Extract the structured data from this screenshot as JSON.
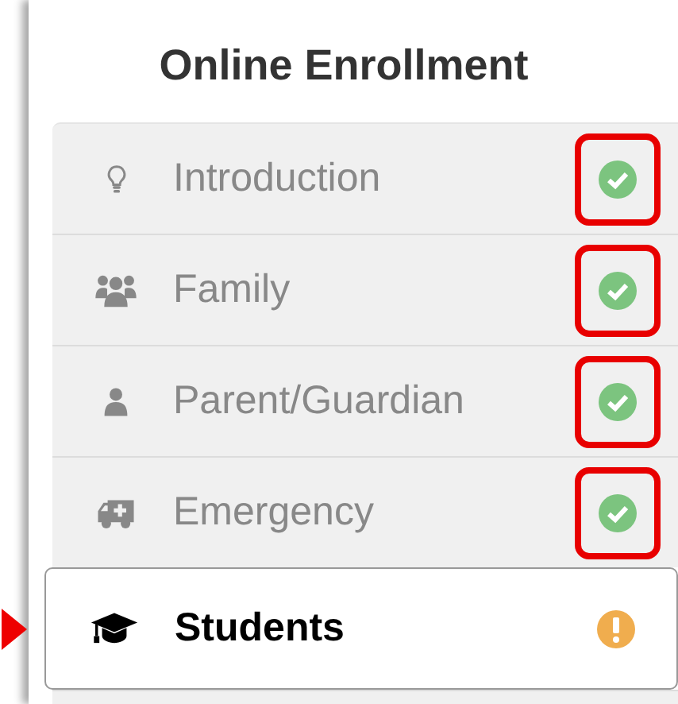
{
  "title": "Online Enrollment",
  "steps": [
    {
      "label": "Introduction",
      "complete": true,
      "selected": false,
      "highlighted": true,
      "pointed": false
    },
    {
      "label": "Family",
      "complete": true,
      "selected": false,
      "highlighted": true,
      "pointed": false
    },
    {
      "label": "Parent/Guardian",
      "complete": true,
      "selected": false,
      "highlighted": true,
      "pointed": false
    },
    {
      "label": "Emergency",
      "complete": true,
      "selected": false,
      "highlighted": true,
      "pointed": false
    },
    {
      "label": "Students",
      "complete": false,
      "selected": true,
      "highlighted": false,
      "pointed": true
    }
  ]
}
